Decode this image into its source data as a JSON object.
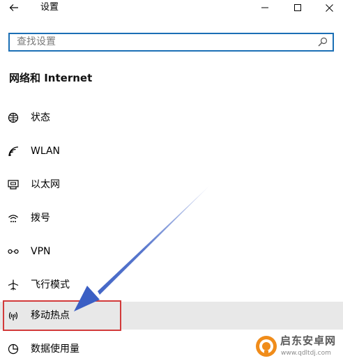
{
  "window": {
    "title": "设置"
  },
  "search": {
    "placeholder": "查找设置"
  },
  "section": {
    "title": "网络和 Internet"
  },
  "nav": {
    "items": [
      {
        "label": "状态",
        "icon": "globe-status-icon"
      },
      {
        "label": "WLAN",
        "icon": "wifi-icon"
      },
      {
        "label": "以太网",
        "icon": "ethernet-icon"
      },
      {
        "label": "拨号",
        "icon": "dialup-icon"
      },
      {
        "label": "VPN",
        "icon": "vpn-icon"
      },
      {
        "label": "飞行模式",
        "icon": "airplane-icon"
      },
      {
        "label": "移动热点",
        "icon": "hotspot-icon",
        "selected": true
      },
      {
        "label": "数据使用量",
        "icon": "data-usage-icon"
      }
    ]
  },
  "annotation": {
    "highlight_color": "#d23a3a",
    "arrow_color": "#3b5fc4"
  },
  "watermark": {
    "brand": "启东安卓网",
    "url": "www.qdltdj.com"
  },
  "colors": {
    "accent": "#1b6fb5",
    "selected_bg": "#e8e8e8"
  }
}
